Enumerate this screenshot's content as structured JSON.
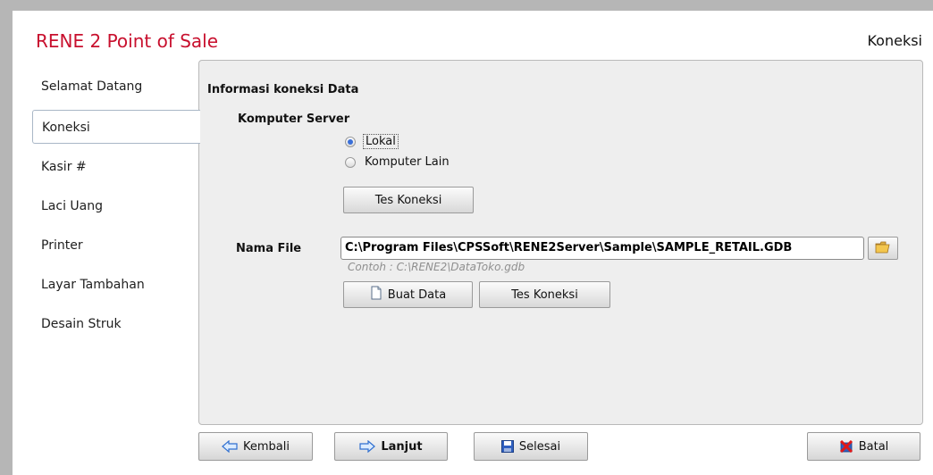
{
  "app_title": "RENE 2 Point of Sale",
  "page_title": "Koneksi",
  "sidebar": {
    "items": [
      {
        "label": "Selamat Datang"
      },
      {
        "label": "Koneksi",
        "active": true
      },
      {
        "label": "Kasir #"
      },
      {
        "label": "Laci Uang"
      },
      {
        "label": "Printer"
      },
      {
        "label": "Layar Tambahan"
      },
      {
        "label": "Desain Struk"
      }
    ]
  },
  "main": {
    "section_title": "Informasi koneksi Data",
    "server_label": "Komputer Server",
    "radio_local": "Lokal",
    "radio_other": "Komputer Lain",
    "selected_server": "Lokal",
    "test_button_1": "Tes Koneksi",
    "file_label": "Nama File",
    "file_path": "C:\\Program Files\\CPSSoft\\RENE2Server\\Sample\\SAMPLE_RETAIL.GDB",
    "file_hint": "Contoh : C:\\RENE2\\DataToko.gdb",
    "create_button": "Buat Data",
    "test_button_2": "Tes Koneksi"
  },
  "footer": {
    "back": "Kembali",
    "next": "Lanjut",
    "finish": "Selesai",
    "cancel": "Batal"
  },
  "colors": {
    "brand_red": "#c8102e",
    "panel_bg": "#eeeeee",
    "radio_blue": "#3a6fd8"
  },
  "icons": {
    "back": "arrow-left-icon",
    "next": "arrow-right-icon",
    "finish": "save-disk-icon",
    "cancel": "close-x-icon",
    "create": "document-icon",
    "browse": "folder-open-icon"
  }
}
